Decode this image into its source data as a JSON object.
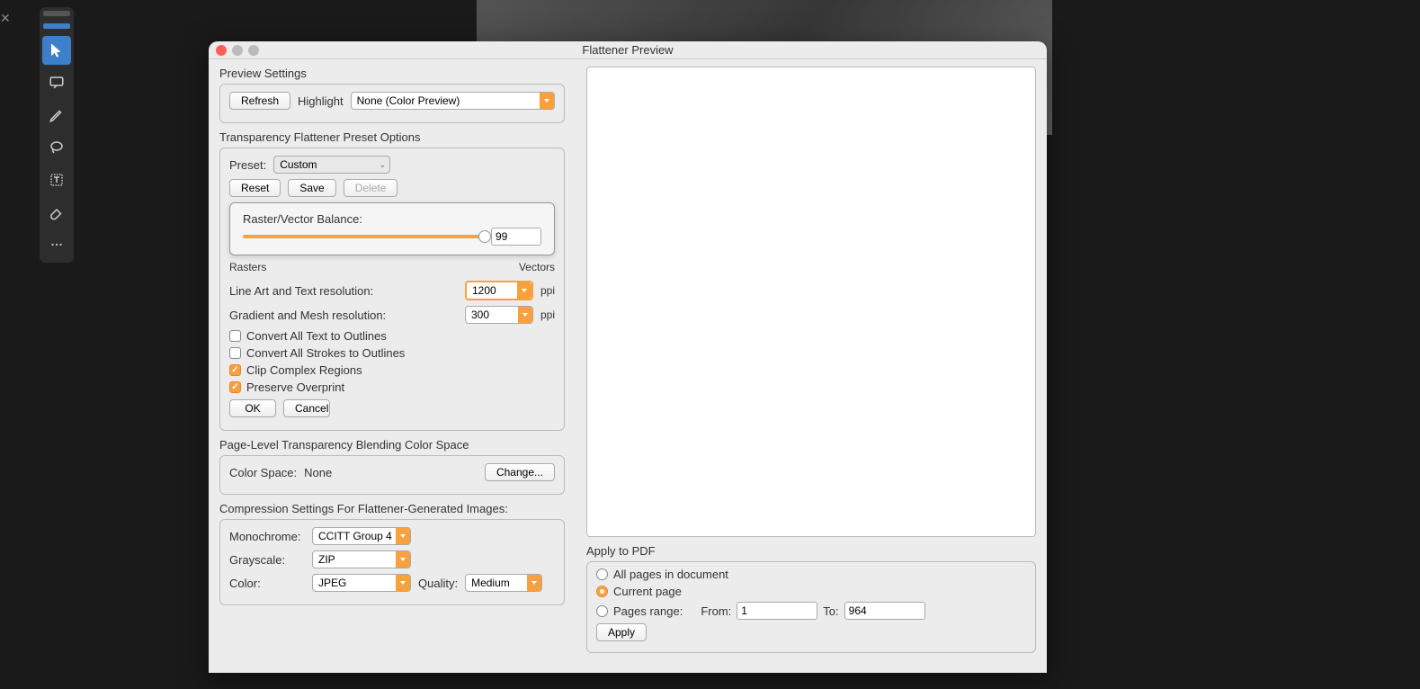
{
  "dialog": {
    "title": "Flattener Preview"
  },
  "preview_settings": {
    "heading": "Preview Settings",
    "refresh": "Refresh",
    "highlight_label": "Highlight",
    "highlight_value": "None (Color Preview)"
  },
  "transparency": {
    "heading": "Transparency Flattener Preset Options",
    "preset_label": "Preset:",
    "preset_value": "Custom",
    "reset": "Reset",
    "save": "Save",
    "delete": "Delete",
    "balance_label": "Raster/Vector Balance:",
    "balance_value": "99",
    "rasters": "Rasters",
    "vectors": "Vectors",
    "line_art_label": "Line Art and Text resolution:",
    "line_art_value": "1200",
    "gradient_label": "Gradient and Mesh resolution:",
    "gradient_value": "300",
    "ppi": "ppi",
    "convert_text": "Convert All Text to Outlines",
    "convert_strokes": "Convert All Strokes to Outlines",
    "clip_complex": "Clip Complex Regions",
    "preserve_overprint": "Preserve Overprint",
    "ok": "OK",
    "cancel": "Cancel"
  },
  "page_level": {
    "heading": "Page-Level Transparency Blending Color Space",
    "color_space_label": "Color Space:",
    "color_space_value": "None",
    "change": "Change..."
  },
  "compression": {
    "heading": "Compression Settings For Flattener-Generated Images:",
    "monochrome_label": "Monochrome:",
    "monochrome_value": "CCITT Group 4",
    "grayscale_label": "Grayscale:",
    "grayscale_value": "ZIP",
    "color_label": "Color:",
    "color_value": "JPEG",
    "quality_label": "Quality:",
    "quality_value": "Medium"
  },
  "apply_pdf": {
    "heading": "Apply to PDF",
    "all_pages": "All pages in document",
    "current_page": "Current page",
    "pages_range": "Pages range:",
    "from_label": "From:",
    "from_value": "1",
    "to_label": "To:",
    "to_value": "964",
    "apply": "Apply"
  }
}
